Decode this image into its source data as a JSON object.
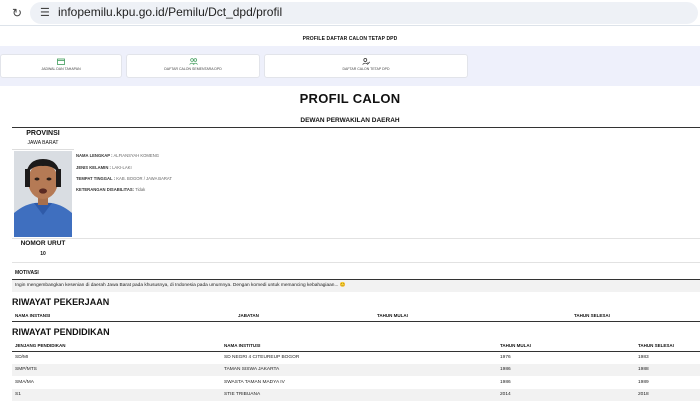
{
  "browser": {
    "url": "infopemilu.kpu.go.id/Pemilu/Dct_dpd/profil"
  },
  "page": {
    "title_bar": "PROFILE DAFTAR CALON TETAP DPD"
  },
  "nav_cards": [
    {
      "label": "JADWAL DAN TAHAPAN"
    },
    {
      "label": "DAFTAR CALON SEMENTARA DPD"
    },
    {
      "label": "DAFTAR CALON TETAP DPD"
    }
  ],
  "profile": {
    "heading": "PROFIL CALON",
    "subheading": "DEWAN PERWAKILAN DAERAH",
    "provinsi_label": "PROVINSI",
    "provinsi_value": "JAWA BARAT",
    "nomor_label": "NOMOR URUT",
    "nomor_value": "10",
    "fields": [
      {
        "label": "NAMA LENGKAP :",
        "value": "ALFIANSYAH KOMENG"
      },
      {
        "label": "JENIS KELAMIN :",
        "value": "LAKI-LAKI"
      },
      {
        "label": "TEMPAT TINGGAL :",
        "value": "KAB. BOGOR / JAWA BARAT"
      },
      {
        "label": "KETERANGAN DISABILITAS:",
        "value": "Tidak"
      }
    ],
    "motivasi_label": "MOTIVASI",
    "motivasi_text": "Ingin mengembangkan kesenian di daerah Jawa Barat pada khususnya, di Indonesia pada umumnya. Dengan komedi untuk memancing kebahagiaan... 😊"
  },
  "pekerjaan": {
    "title": "RIWAYAT PEKERJAAN",
    "headers": [
      "NAMA INSTANSI",
      "JABATAN",
      "TAHUN MULAI",
      "TAHUN SELESAI"
    ]
  },
  "pendidikan": {
    "title": "RIWAYAT PENDIDIKAN",
    "headers": [
      "JENJANG PENDIDIKAN",
      "NAMA INSTITUSI",
      "TAHUN MULAI",
      "TAHUN SELESAI"
    ],
    "rows": [
      [
        "SD/MI",
        "SD NEGRI 4 CITEUREUP BOGOR",
        "1976",
        "1983"
      ],
      [
        "SMP/MTS",
        "TAMAN SISWA JAKARTA",
        "1986",
        "1988"
      ],
      [
        "SMA/MA",
        "SWASTA TAMAN MADYA IV",
        "1986",
        "1989"
      ],
      [
        "S1",
        "STIE TRIBUANA",
        "2014",
        "2018"
      ]
    ]
  },
  "icons": {
    "reload": "reload-icon",
    "tune": "site-settings-icon",
    "calendar": "calendar-icon",
    "people": "people-icon",
    "user_check": "user-check-icon"
  },
  "colors": {
    "accent_green": "#3e9b5a",
    "band": "#eef0fb"
  }
}
